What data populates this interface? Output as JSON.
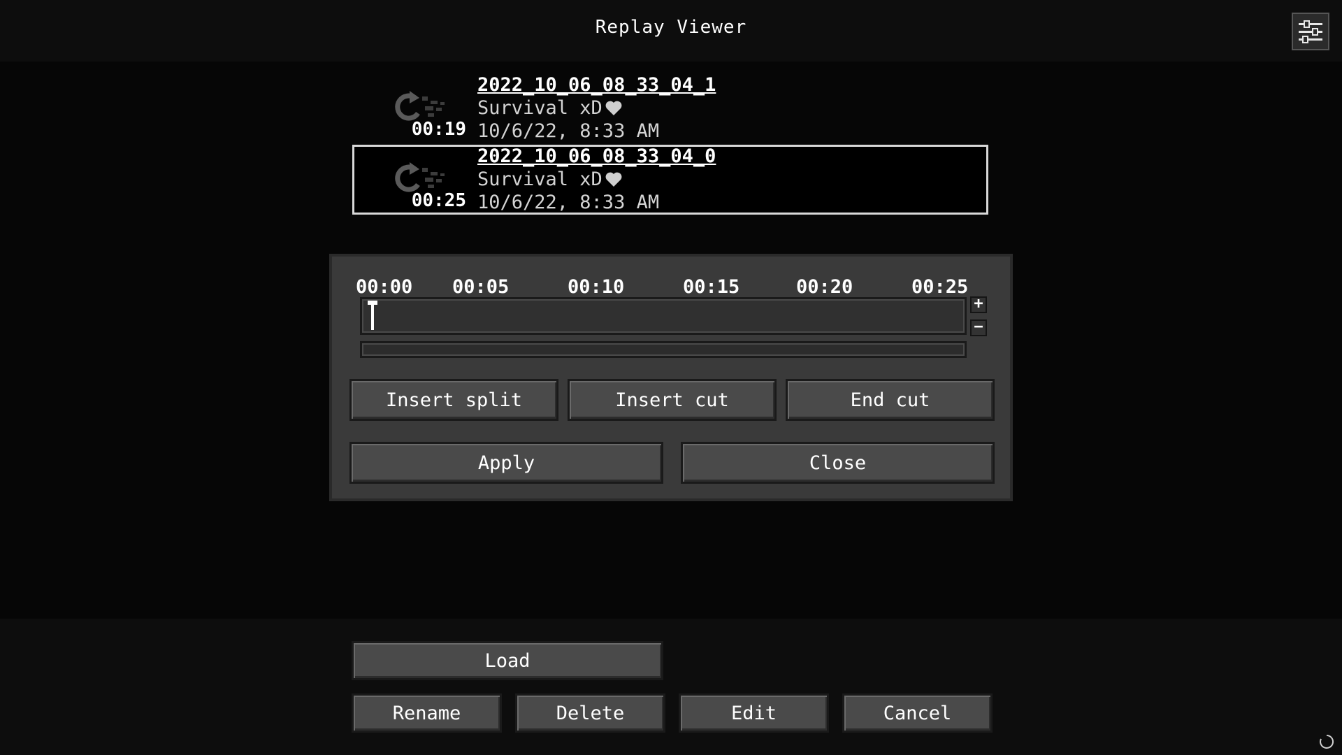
{
  "window": {
    "title": "Replay Viewer"
  },
  "settings": {
    "icon": "sliders-icon"
  },
  "replays": [
    {
      "name": "2022_10_06_08_33_04_1",
      "world": "Survival xD",
      "date": "10/6/22, 8:33 AM",
      "duration": "00:19",
      "selected": false
    },
    {
      "name": "2022_10_06_08_33_04_0",
      "world": "Survival xD",
      "date": "10/6/22, 8:33 AM",
      "duration": "00:25",
      "selected": true
    }
  ],
  "editor": {
    "ticks": [
      "00:00",
      "00:05",
      "00:10",
      "00:15",
      "00:20",
      "00:25"
    ],
    "zoom_in": "+",
    "zoom_out": "−",
    "cursor_time": "00:00",
    "buttons": {
      "insert_split": "Insert split",
      "insert_cut": "Insert cut",
      "end_cut": "End cut",
      "apply": "Apply",
      "close": "Close"
    }
  },
  "actions": {
    "load": "Load",
    "rename": "Rename",
    "delete": "Delete",
    "edit": "Edit",
    "cancel": "Cancel"
  },
  "colors": {
    "background": "#060606",
    "panel": "#3a3a3a",
    "button": "#4a4a4a",
    "selection_border": "#d8d8d8"
  }
}
